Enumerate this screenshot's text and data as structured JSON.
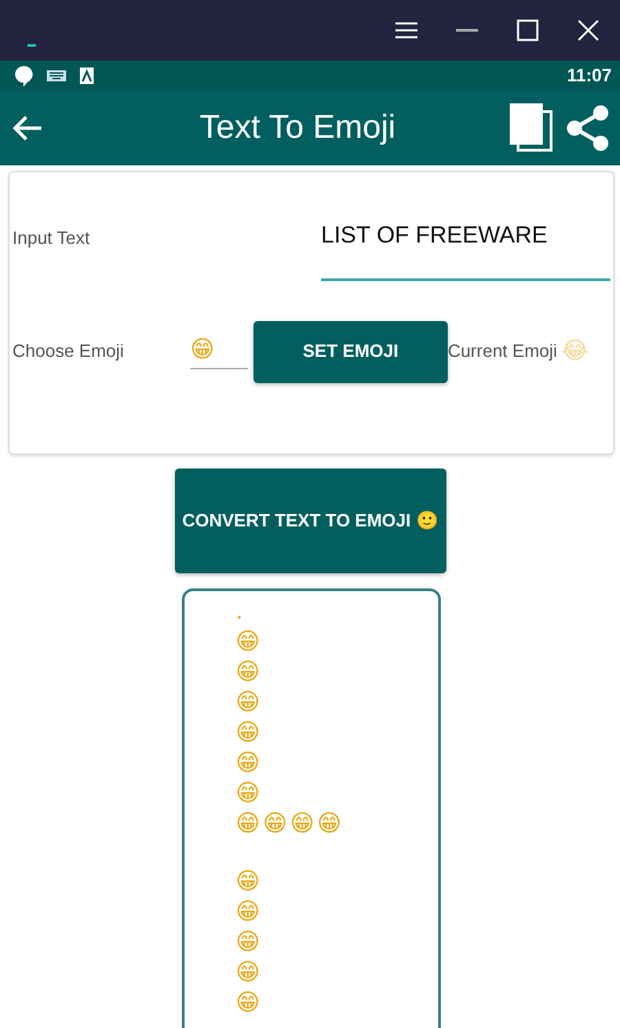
{
  "window": {
    "buttons": [
      {
        "kind": "menu"
      },
      {
        "kind": "minimize"
      },
      {
        "kind": "maximize"
      },
      {
        "kind": "close"
      }
    ]
  },
  "status_bar": {
    "time": "11:07"
  },
  "app_bar": {
    "title": "Text To Emoji"
  },
  "input": {
    "label": "Input Text",
    "value": "LIST OF FREEWARE"
  },
  "emoji_row": {
    "label": "Choose Emoji",
    "value": "😁",
    "button": "SET EMOJI",
    "current_label": "Current Emoji",
    "current": "😂"
  },
  "convert_button": "CONVERT TEXT TO EMOJI 🙂",
  "output": [
    {
      "text": "."
    },
    {
      "text": "😁"
    },
    {
      "text": "😁"
    },
    {
      "text": "😁"
    },
    {
      "text": "😁"
    },
    {
      "text": "😁"
    },
    {
      "text": "😁"
    },
    {
      "text": "😁😁😁😁"
    },
    {
      "kind": "blank"
    },
    {
      "text": "😁"
    },
    {
      "text": "😁"
    },
    {
      "text": "😁"
    },
    {
      "text": "😁"
    },
    {
      "text": "😁"
    }
  ]
}
